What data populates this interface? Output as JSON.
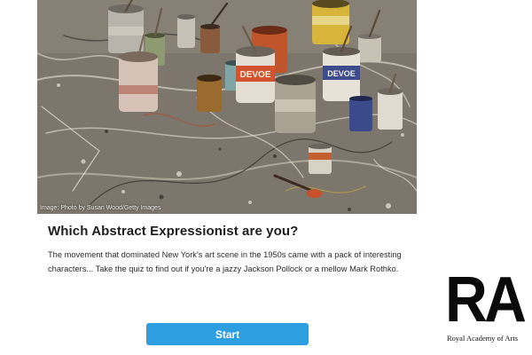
{
  "hero": {
    "credit": "Image: Photo by Susan Wood/Getty Images",
    "can_label": "DEVOE"
  },
  "quiz": {
    "title": "Which Abstract Expressionist are you?",
    "description": "The movement that dominated New York's art scene in the 1950s came with a pack of interesting characters... Take the quiz to find out if you're a jazzy Jackson Pollock or a mellow Mark Rothko.",
    "start_label": "Start"
  },
  "logo": {
    "mark": "RA",
    "name": "Royal Academy of Arts"
  },
  "colors": {
    "accent": "#2d9ee0",
    "text": "#1e1e1e",
    "logo": "#0a0a0a"
  }
}
